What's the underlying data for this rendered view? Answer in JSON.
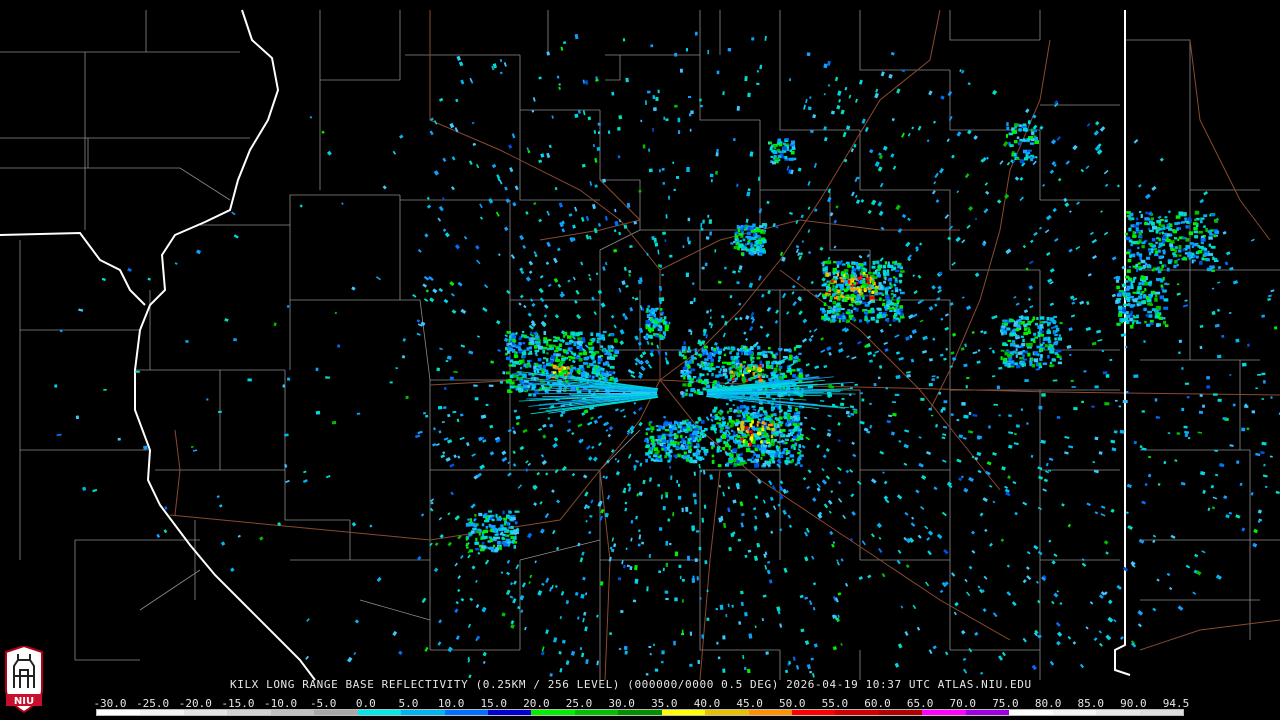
{
  "product_title": "KILX LONG RANGE BASE REFLECTIVITY (0.25KM / 256 LEVEL) (000000/0000 0.5 DEG) 2026-04-19 10:37 UTC  ATLAS.NIU.EDU",
  "logo_text": "NIU",
  "scale": {
    "labels": [
      "-30.0",
      "-25.0",
      "-20.0",
      "-15.0",
      "-10.0",
      "-5.0",
      "0.0",
      "5.0",
      "10.0",
      "15.0",
      "20.0",
      "25.0",
      "30.0",
      "35.0",
      "40.0",
      "45.0",
      "50.0",
      "55.0",
      "60.0",
      "65.0",
      "70.0",
      "75.0",
      "80.0",
      "85.0",
      "90.0",
      "94.5"
    ],
    "colors": [
      "#ffffff",
      "#f2f2f2",
      "#e3e3e3",
      "#d2d2d2",
      "#c0c0c0",
      "#a8a8a8",
      "#00e8e8",
      "#00b4f0",
      "#0070ff",
      "#0000d0",
      "#00f000",
      "#00c000",
      "#009000",
      "#ffff00",
      "#e8c000",
      "#ff9000",
      "#ff0000",
      "#d00000",
      "#b00000",
      "#ff00ff",
      "#a000e0",
      "#ffffff",
      "#f4f4f4",
      "#e8e8e8",
      "#dedede"
    ]
  },
  "colors": {
    "background": "#000000",
    "county_lines": "#8c8c8c",
    "state_lines": "#ffffff",
    "highways": "#8a4a30"
  }
}
